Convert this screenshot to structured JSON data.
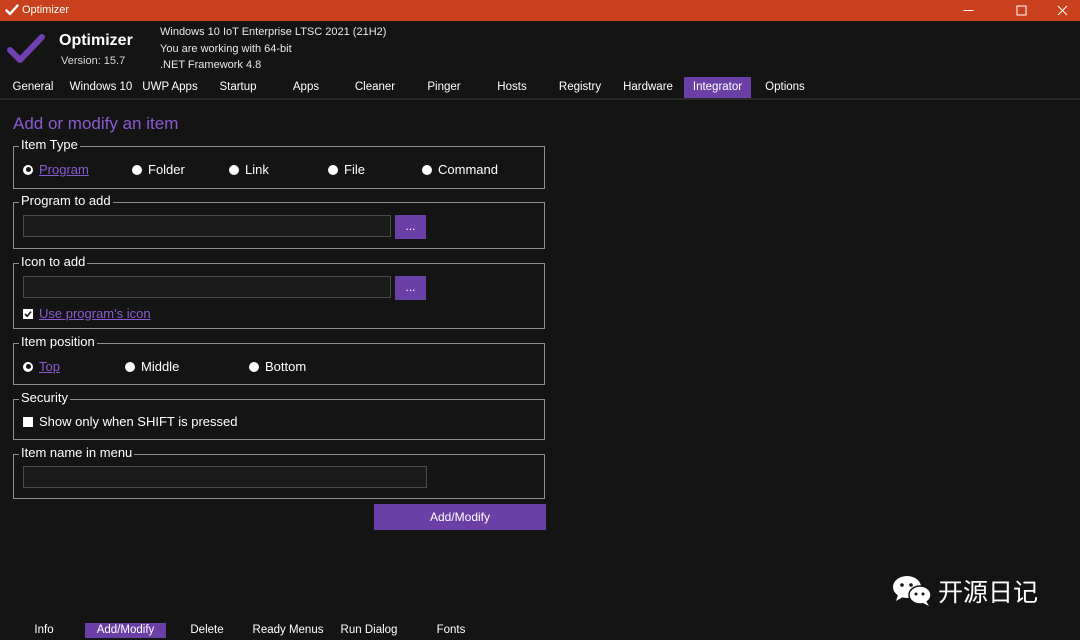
{
  "window": {
    "title": "Optimizer",
    "titlebar_color": "#c8401c",
    "controls": [
      "minimize-icon",
      "maximize-icon",
      "close-icon"
    ]
  },
  "header": {
    "app_name": "Optimizer",
    "version": "Version: 15.7",
    "os_line": "Windows 10 IoT Enterprise LTSC 2021 (21H2)",
    "arch_line": "You are working with 64-bit",
    "framework_line": ".NET Framework 4.8"
  },
  "tabs": {
    "items": [
      "General",
      "Windows 10",
      "UWP Apps",
      "Startup",
      "Apps",
      "Cleaner",
      "Pinger",
      "Hosts",
      "Registry",
      "Hardware",
      "Integrator",
      "Options"
    ],
    "active": "Integrator"
  },
  "content": {
    "title": "Add or modify an item",
    "item_type": {
      "legend": "Item Type",
      "options": [
        "Program",
        "Folder",
        "Link",
        "File",
        "Command"
      ],
      "selected": "Program"
    },
    "program": {
      "legend": "Program to add",
      "value": "",
      "browse_label": "..."
    },
    "icon": {
      "legend": "Icon to add",
      "value": "",
      "browse_label": "...",
      "use_program_icon_label": "Use program's icon",
      "use_program_icon_checked": true
    },
    "position": {
      "legend": "Item position",
      "options": [
        "Top",
        "Middle",
        "Bottom"
      ],
      "selected": "Top"
    },
    "security": {
      "legend": "Security",
      "shift_label": "Show only when SHIFT is pressed",
      "shift_checked": false
    },
    "item_name": {
      "legend": "Item name in menu",
      "value": ""
    },
    "submit_label": "Add/Modify"
  },
  "watermark": {
    "text": "开源日记"
  },
  "bottom_tabs": {
    "items": [
      "Info",
      "Add/Modify",
      "Delete",
      "Ready Menus",
      "Run Dialog",
      "Fonts"
    ],
    "active": "Add/Modify"
  },
  "colors": {
    "accent": "#6a3fa6",
    "accent_text": "#8a5bd0",
    "background": "#141414"
  }
}
